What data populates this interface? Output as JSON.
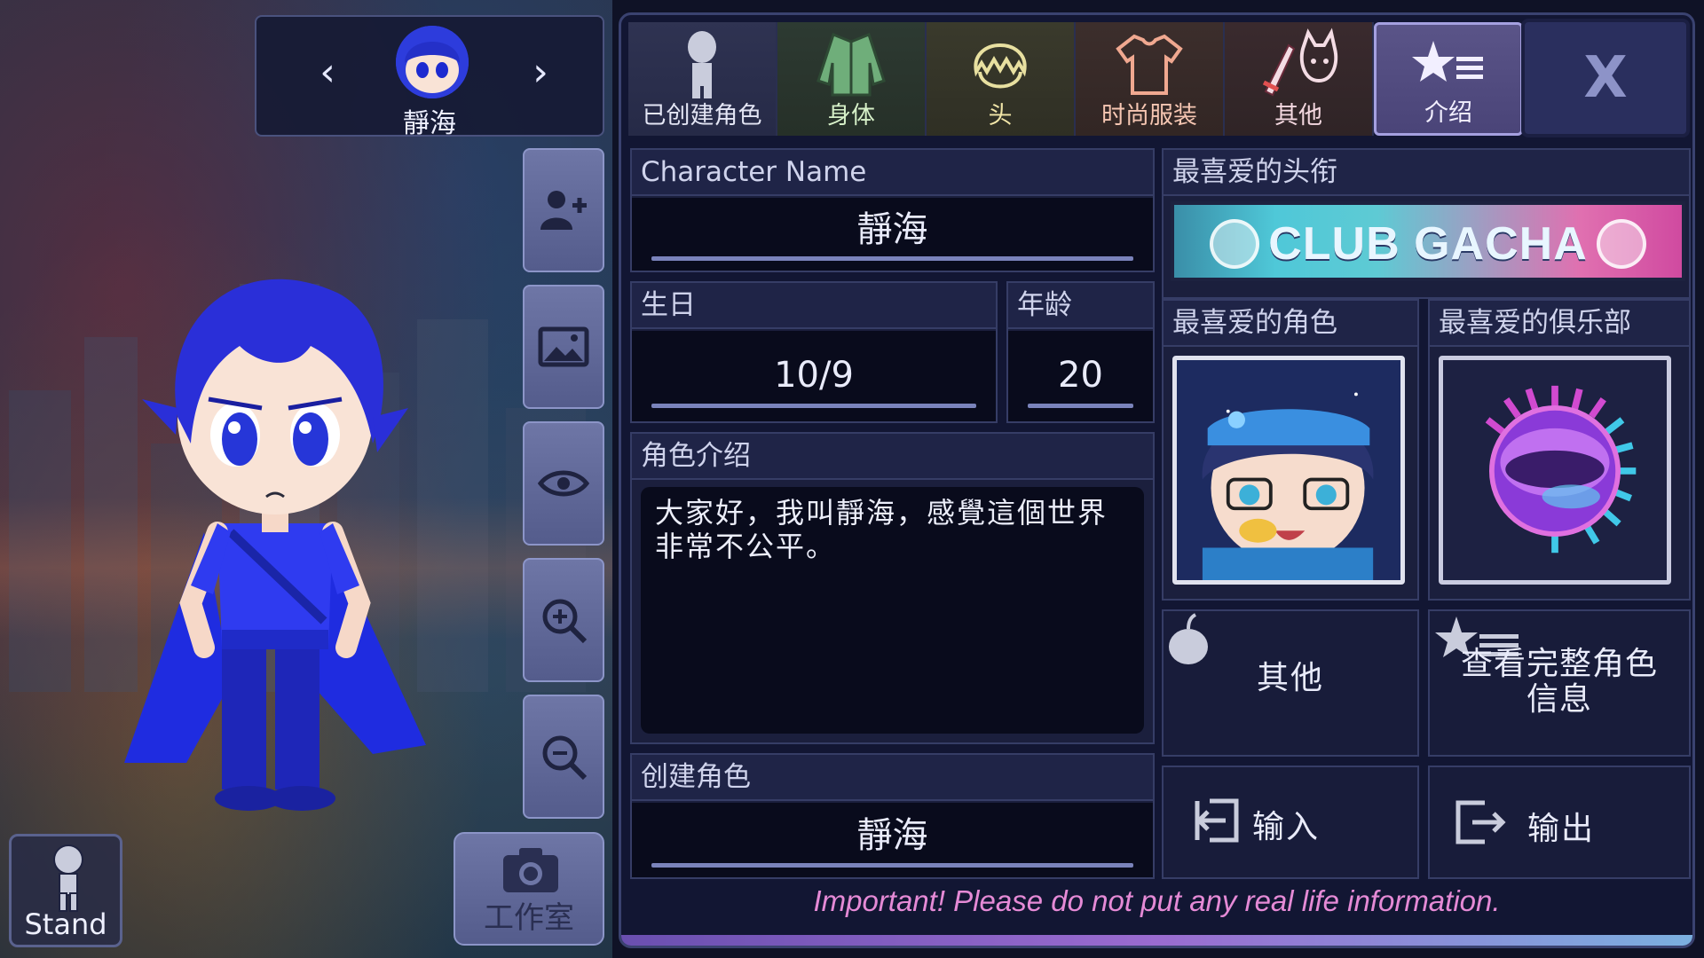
{
  "character": {
    "name": "靜海"
  },
  "stage": {
    "stand_label": "Stand",
    "studio_label": "工作室",
    "tools": [
      {
        "name": "add-character-button",
        "icon": "add-user-icon"
      },
      {
        "name": "background-button",
        "icon": "image-icon"
      },
      {
        "name": "visibility-button",
        "icon": "eye-icon"
      },
      {
        "name": "zoom-in-button",
        "icon": "zoom-in-icon"
      },
      {
        "name": "zoom-out-button",
        "icon": "zoom-out-icon"
      }
    ]
  },
  "tabs": [
    {
      "label": "已创建角色",
      "icon": "character-silhouette-icon"
    },
    {
      "label": "身体",
      "icon": "jacket-icon"
    },
    {
      "label": "头",
      "icon": "hair-icon"
    },
    {
      "label": "时尚服装",
      "icon": "tshirt-icon"
    },
    {
      "label": "其他",
      "icon": "sword-cat-icon"
    },
    {
      "label": "介绍",
      "icon": "star-list-icon",
      "active": true
    }
  ],
  "close_label": "X",
  "profile": {
    "name_title": "Character Name",
    "name_value": "靜海",
    "birthday_title": "生日",
    "birthday_value": "10/9",
    "age_title": "年龄",
    "age_value": "20",
    "bio_title": "角色介绍",
    "bio_value": "大家好，我叫靜海，感覺這個世界非常不公平。",
    "creator_title": "创建角色",
    "creator_value": "靜海",
    "fav_title_label": "最喜爱的头衔",
    "fav_title_badge": "CLUB GACHA",
    "fav_character_label": "最喜爱的角色",
    "fav_club_label": "最喜爱的俱乐部",
    "other_label": "其他",
    "full_profile_label": "查看完整角色信息",
    "import_label": "输入",
    "export_label": "输出"
  },
  "warning": "Important! Please do not put any real life information.",
  "colors": {
    "accent": "#4a44a8",
    "warning": "#e58ad6",
    "character_hair": "#2a2fd8"
  }
}
